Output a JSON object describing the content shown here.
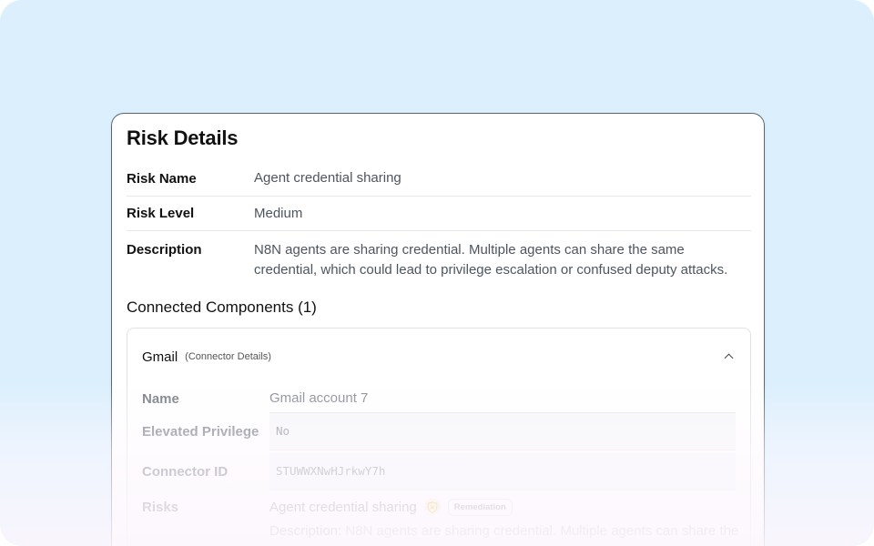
{
  "card": {
    "title": "Risk Details",
    "fields": [
      {
        "label": "Risk Name",
        "value": "Agent credential sharing"
      },
      {
        "label": "Risk Level",
        "value": "Medium"
      },
      {
        "label": "Description",
        "value": "N8N agents are sharing credential. Multiple agents can share the same credential, which could lead to privilege escalation or confused deputy attacks."
      }
    ],
    "connected_title": "Connected Components (1)"
  },
  "component": {
    "name": "Gmail",
    "subtitle": "(Connector Details)",
    "expand_icon": "chevron-up-icon",
    "details": [
      {
        "label": "Name",
        "value": "Gmail account 7"
      },
      {
        "label": "Elevated Privilege",
        "value": "No"
      },
      {
        "label": "Connector ID",
        "value": "STUWWXNwHJrkwY7h"
      }
    ],
    "risks": {
      "label": "Risks",
      "risk_name": "Agent credential sharing",
      "icon": "shield-icon",
      "badge": "Remediation",
      "description_label": "Description:",
      "description_text": "N8N agents are sharing credential. Multiple agents can share the"
    }
  },
  "colors": {
    "background": "#dbeffd",
    "shield": "#f4d77a"
  }
}
